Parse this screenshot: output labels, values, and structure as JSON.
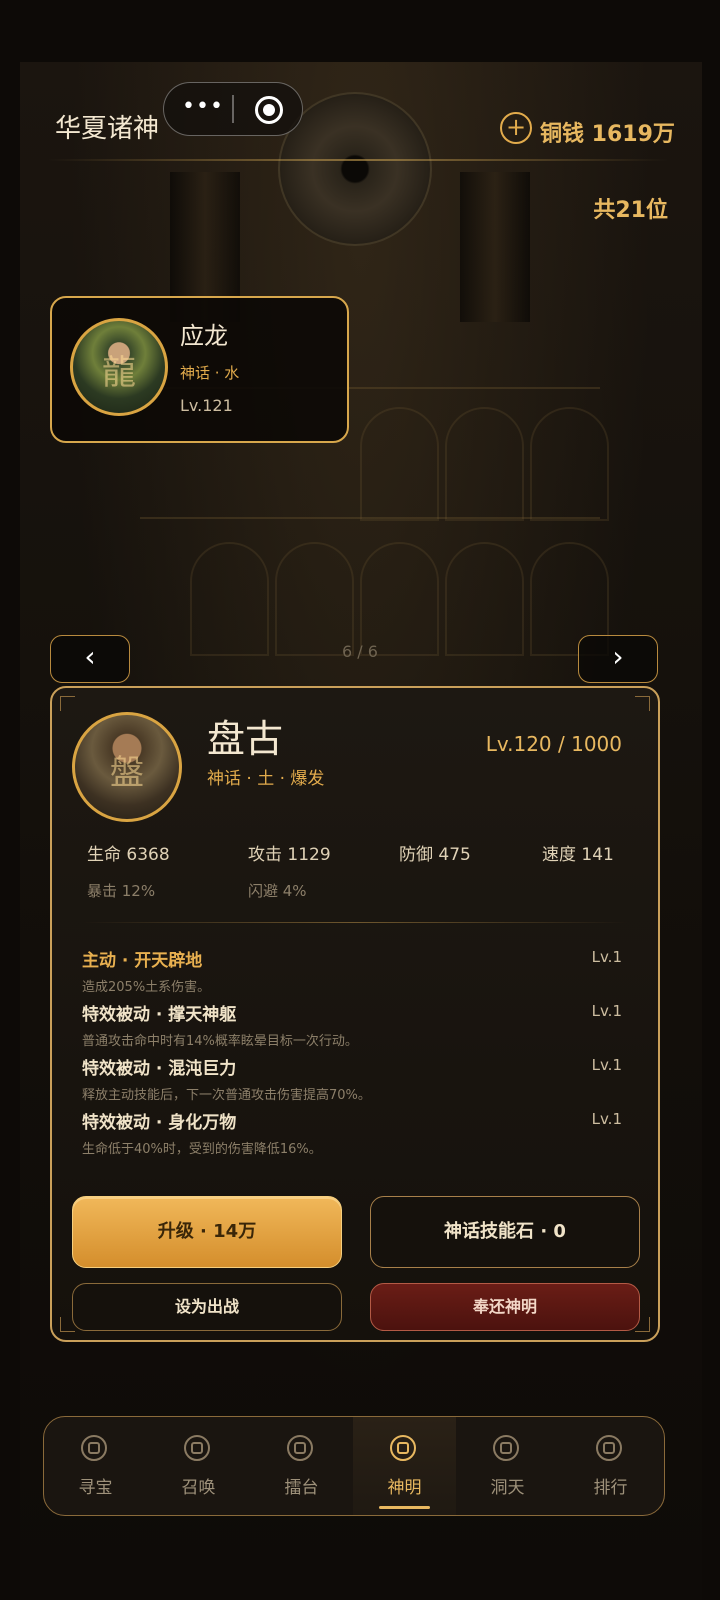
{
  "header": {
    "title": "华夏诸神",
    "coins_label": "铜钱 1619万",
    "count_label": "共21位"
  },
  "selected": {
    "name": "应龙",
    "tags": "神话 · 水",
    "level": "Lv.121"
  },
  "pager": {
    "text": "6 / 6",
    "prev": "‹",
    "next": "›"
  },
  "hero": {
    "name": "盘古",
    "tags": "神话 · 土 · 爆发",
    "level": "Lv.120 / 1000",
    "stats": {
      "hp": "生命 6368",
      "atk": "攻击 1129",
      "def": "防御 475",
      "spd": "速度 141",
      "crit": "暴击 12%",
      "dodge": "闪避 4%"
    },
    "skills": [
      {
        "name": "主动 · 开天辟地",
        "level": "Lv.1",
        "desc": "造成205%土系伤害。",
        "color": "#e8b050"
      },
      {
        "name": "特效被动 · 撑天神躯",
        "level": "Lv.1",
        "desc": "普通攻击命中时有14%概率眩晕目标一次行动。",
        "color": "#f0e3c8"
      },
      {
        "name": "特效被动 · 混沌巨力",
        "level": "Lv.1",
        "desc": "释放主动技能后，下一次普通攻击伤害提高70%。",
        "color": "#f0e3c8"
      },
      {
        "name": "特效被动 · 身化万物",
        "level": "Lv.1",
        "desc": "生命低于40%时，受到的伤害降低16%。",
        "color": "#f0e3c8"
      }
    ]
  },
  "buttons": {
    "upgrade": "升级 · 14万",
    "skill_stone": "神话技能石 · 0",
    "deploy": "设为出战",
    "return": "奉还神明"
  },
  "tabs": [
    {
      "label": "寻宝",
      "icon": "treasure-icon"
    },
    {
      "label": "召唤",
      "icon": "summon-icon"
    },
    {
      "label": "擂台",
      "icon": "arena-icon"
    },
    {
      "label": "神明",
      "icon": "deity-icon"
    },
    {
      "label": "洞天",
      "icon": "grotto-icon"
    },
    {
      "label": "排行",
      "icon": "ranking-icon"
    }
  ],
  "colors": {
    "accent": "#e8b860",
    "gold_border": "#d7a74c",
    "danger": "#6a1d16",
    "background": "#120e0a"
  }
}
